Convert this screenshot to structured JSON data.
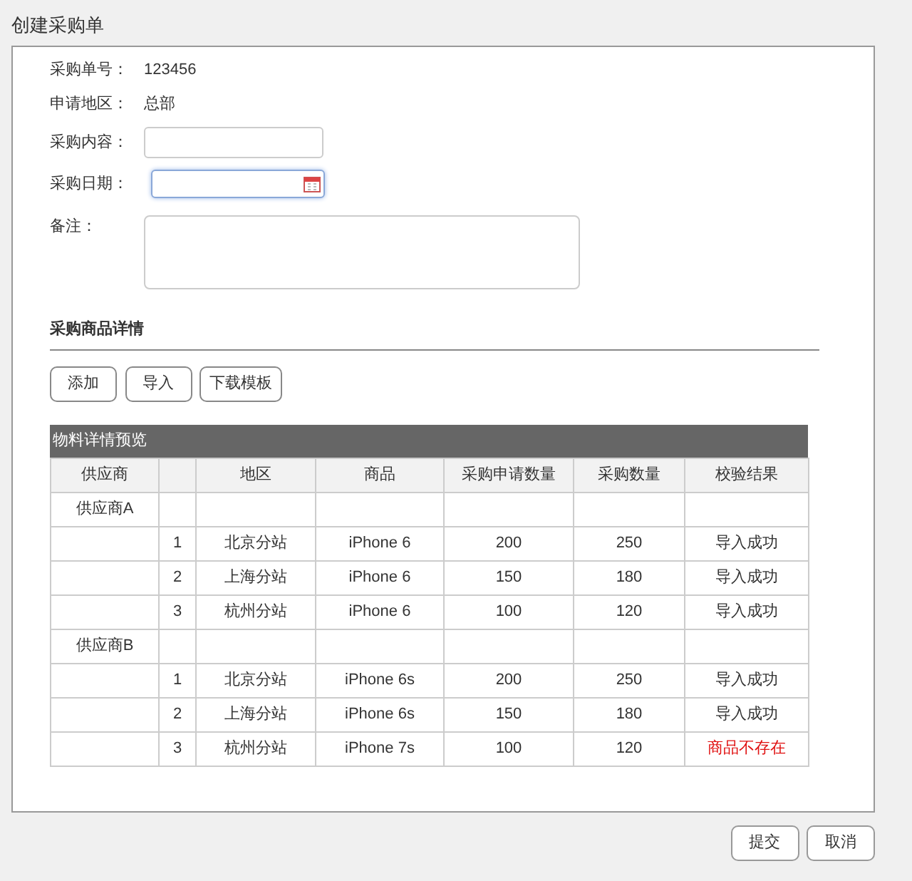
{
  "window": {
    "title": "创建采购单"
  },
  "form": [
    {
      "kind": "text",
      "label": "采购单号：",
      "value": "123456"
    },
    {
      "kind": "text",
      "label": "申请地区：",
      "value": "总部"
    },
    {
      "kind": "input",
      "label": "采购内容：",
      "focused": false
    },
    {
      "kind": "date",
      "label": "采购日期：",
      "focused": true
    },
    {
      "kind": "textarea",
      "label": "备注："
    }
  ],
  "section": {
    "title": "采购商品详情"
  },
  "actions": [
    "添加",
    "导入",
    "下载模板"
  ],
  "table": {
    "title": "物料详情预览",
    "columns": [
      "供应商",
      "",
      "地区",
      "商品",
      "采购申请数量",
      "采购数量",
      "校验结果"
    ],
    "groups": [
      {
        "supplier": "供应商A",
        "rows": [
          {
            "index": "1",
            "region": "北京分站",
            "product": "iPhone 6",
            "requested": "200",
            "quantity": "250",
            "result": "导入成功",
            "kind": "success"
          },
          {
            "index": "2",
            "region": "上海分站",
            "product": "iPhone 6",
            "requested": "150",
            "quantity": "180",
            "result": "导入成功",
            "kind": "success"
          },
          {
            "index": "3",
            "region": "杭州分站",
            "product": "iPhone 6",
            "requested": "100",
            "quantity": "120",
            "result": "导入成功",
            "kind": "success"
          }
        ]
      },
      {
        "supplier": "供应商B",
        "rows": [
          {
            "index": "1",
            "region": "北京分站",
            "product": "iPhone 6s",
            "requested": "200",
            "quantity": "250",
            "result": "导入成功",
            "kind": "success"
          },
          {
            "index": "2",
            "region": "上海分站",
            "product": "iPhone 6s",
            "requested": "150",
            "quantity": "180",
            "result": "导入成功",
            "kind": "success"
          },
          {
            "index": "3",
            "region": "杭州分站",
            "product": "iPhone 7s",
            "requested": "100",
            "quantity": "120",
            "result": "商品不存在",
            "kind": "error"
          }
        ]
      }
    ]
  },
  "footer": [
    "提交",
    "取消"
  ]
}
